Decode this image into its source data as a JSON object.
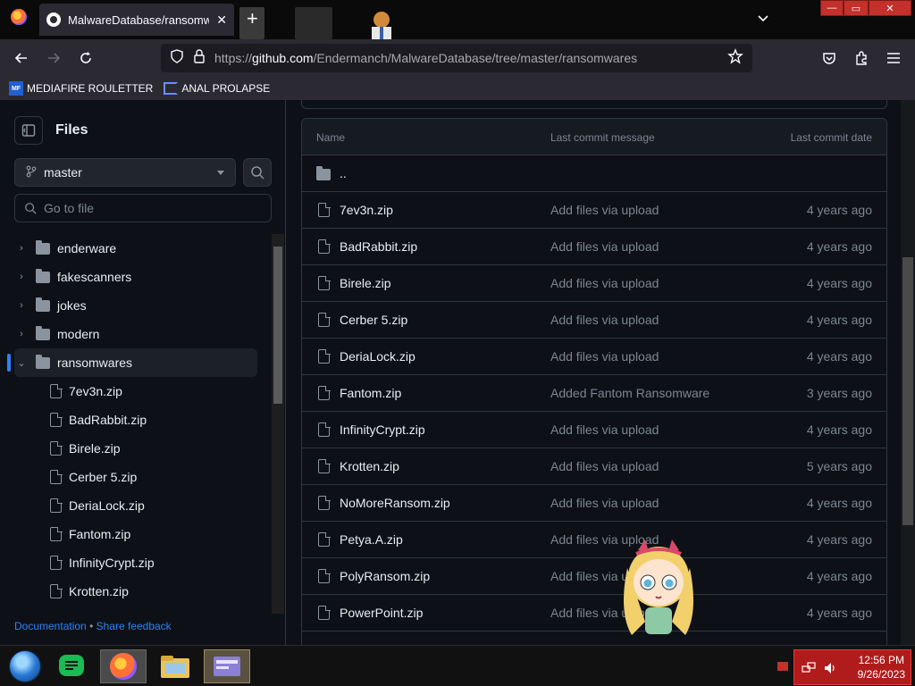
{
  "browser": {
    "tab_title": "MalwareDatabase/ransomware",
    "url_prefix": "https://",
    "url_host": "github.com",
    "url_path": "/Endermanch/MalwareDatabase/tree/master/ransomwares",
    "bookmarks": [
      "MEDIAFIRE ROULETTER",
      "ANAL PROLAPSE"
    ],
    "bookmark_icon_text": "MF"
  },
  "sidebar": {
    "title": "Files",
    "branch": "master",
    "goto_placeholder": "Go to file",
    "folders": [
      "enderware",
      "fakescanners",
      "jokes",
      "modern",
      "ransomwares"
    ],
    "selected_folder": "ransomwares",
    "files": [
      "7ev3n.zip",
      "BadRabbit.zip",
      "Birele.zip",
      "Cerber 5.zip",
      "DeriaLock.zip",
      "Fantom.zip",
      "InfinityCrypt.zip",
      "Krotten.zip"
    ],
    "footer_doc": "Documentation",
    "footer_sep": "•",
    "footer_feedback": "Share feedback"
  },
  "table": {
    "headers": {
      "name": "Name",
      "message": "Last commit message",
      "date": "Last commit date"
    },
    "parent": "..",
    "rows": [
      {
        "name": "7ev3n.zip",
        "message": "Add files via upload",
        "date": "4 years ago"
      },
      {
        "name": "BadRabbit.zip",
        "message": "Add files via upload",
        "date": "4 years ago"
      },
      {
        "name": "Birele.zip",
        "message": "Add files via upload",
        "date": "4 years ago"
      },
      {
        "name": "Cerber 5.zip",
        "message": "Add files via upload",
        "date": "4 years ago"
      },
      {
        "name": "DeriaLock.zip",
        "message": "Add files via upload",
        "date": "4 years ago"
      },
      {
        "name": "Fantom.zip",
        "message": "Added Fantom Ransomware",
        "date": "3 years ago"
      },
      {
        "name": "InfinityCrypt.zip",
        "message": "Add files via upload",
        "date": "4 years ago"
      },
      {
        "name": "Krotten.zip",
        "message": "Add files via upload",
        "date": "5 years ago"
      },
      {
        "name": "NoMoreRansom.zip",
        "message": "Add files via upload",
        "date": "4 years ago"
      },
      {
        "name": "Petya.A.zip",
        "message": "Add files via upload",
        "date": "4 years ago"
      },
      {
        "name": "PolyRansom.zip",
        "message": "Add files via upload",
        "date": "4 years ago"
      },
      {
        "name": "PowerPoint.zip",
        "message": "Add files via upload",
        "date": "4 years ago"
      }
    ]
  },
  "taskbar": {
    "time": "12:56 PM",
    "date": "9/26/2023"
  },
  "colors": {
    "accent": "#2f81f7",
    "bg": "#0d1117",
    "border": "#30363d",
    "muted": "#7d8590"
  }
}
